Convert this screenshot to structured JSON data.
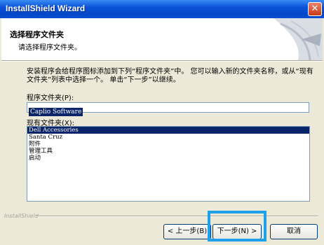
{
  "window": {
    "title": "InstallShield Wizard",
    "close_symbol": "✕"
  },
  "header": {
    "title": "选择程序文件夹",
    "subtitle": "请选择程序文件夹。"
  },
  "description": "安装程序会给程序图标添加到下列“程序文件夹”中。 您可以输入新的文件夹名称，或从“现有文件夹”列表中选择一个。 单击“下一步”以继续。",
  "program_folder": {
    "label": "程序文件夹(P):",
    "value": "Caplio Software"
  },
  "existing_folders": {
    "label": "现有文件夹(X):",
    "items": [
      "Dell Accessories",
      "Santa Cruz",
      "附件",
      "管理工具",
      "启动"
    ],
    "selected_index": 0
  },
  "footer": {
    "brand": "InstallShield"
  },
  "buttons": {
    "back": "< 上一步(B)",
    "next": "下一步(N) >",
    "cancel": "取消"
  },
  "colors": {
    "highlight": "#1ea0ea",
    "selection": "#0a246a",
    "titlebar": "#0a52d8"
  }
}
